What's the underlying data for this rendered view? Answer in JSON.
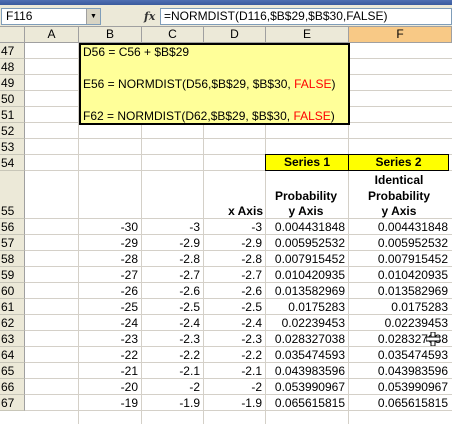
{
  "formula_bar": {
    "name_box": "F116",
    "fx_symbol": "fx",
    "formula": "=NORMDIST(D116,$B$29,$B$30,FALSE)"
  },
  "columns": [
    "A",
    "B",
    "C",
    "D",
    "E",
    "F"
  ],
  "selected_column": "F",
  "rows": {
    "upper": [
      "47",
      "48",
      "49",
      "50",
      "51",
      "52",
      "53",
      "54"
    ],
    "header_row": "55",
    "data": [
      "56",
      "57",
      "58",
      "59",
      "60",
      "61",
      "62",
      "63",
      "64",
      "65",
      "66",
      "67"
    ]
  },
  "note": {
    "line1": "D56 = C56 + $B$29",
    "line2_prefix": "E56 = NORMDIST(D56,$B$29, $B$30, ",
    "line2_false": "FALSE",
    "line2_suffix": ")",
    "line3_prefix": "F62 = NORMDIST(D62,$B$29, $B$30, ",
    "line3_false": "FALSE",
    "line3_suffix": ")"
  },
  "series_headers": {
    "e": "Series 1",
    "f": "Series 2"
  },
  "column_headers": {
    "d": "x Axis",
    "e_line1": "Probability",
    "e_line2": "y Axis",
    "f_line1": "Identical",
    "f_line2": "Probability",
    "f_line3": "y Axis"
  },
  "table": [
    {
      "b": "-30",
      "c": "-3",
      "d": "-3",
      "e": "0.004431848",
      "f": "0.004431848"
    },
    {
      "b": "-29",
      "c": "-2.9",
      "d": "-2.9",
      "e": "0.005952532",
      "f": "0.005952532"
    },
    {
      "b": "-28",
      "c": "-2.8",
      "d": "-2.8",
      "e": "0.007915452",
      "f": "0.007915452"
    },
    {
      "b": "-27",
      "c": "-2.7",
      "d": "-2.7",
      "e": "0.010420935",
      "f": "0.010420935"
    },
    {
      "b": "-26",
      "c": "-2.6",
      "d": "-2.6",
      "e": "0.013582969",
      "f": "0.013582969"
    },
    {
      "b": "-25",
      "c": "-2.5",
      "d": "-2.5",
      "e": "0.0175283",
      "f": "0.0175283"
    },
    {
      "b": "-24",
      "c": "-2.4",
      "d": "-2.4",
      "e": "0.02239453",
      "f": "0.02239453"
    },
    {
      "b": "-23",
      "c": "-2.3",
      "d": "-2.3",
      "e": "0.028327038",
      "f": "0.028327038"
    },
    {
      "b": "-22",
      "c": "-2.2",
      "d": "-2.2",
      "e": "0.035474593",
      "f": "0.035474593"
    },
    {
      "b": "-21",
      "c": "-2.1",
      "d": "-2.1",
      "e": "0.043983596",
      "f": "0.043983596"
    },
    {
      "b": "-20",
      "c": "-2",
      "d": "-2",
      "e": "0.053990967",
      "f": "0.053990967"
    },
    {
      "b": "-19",
      "c": "-1.9",
      "d": "-1.9",
      "e": "0.065615815",
      "f": "0.065615815"
    }
  ],
  "icons": {
    "namebox_dropdown": "chevron-down-icon",
    "cell_cursor": "crosshair-cursor-icon"
  },
  "colors": {
    "note_fill": "#ffff99",
    "series_fill": "#ffff00",
    "false_text": "#ff0000",
    "selected_column_header": "#f8c986"
  }
}
